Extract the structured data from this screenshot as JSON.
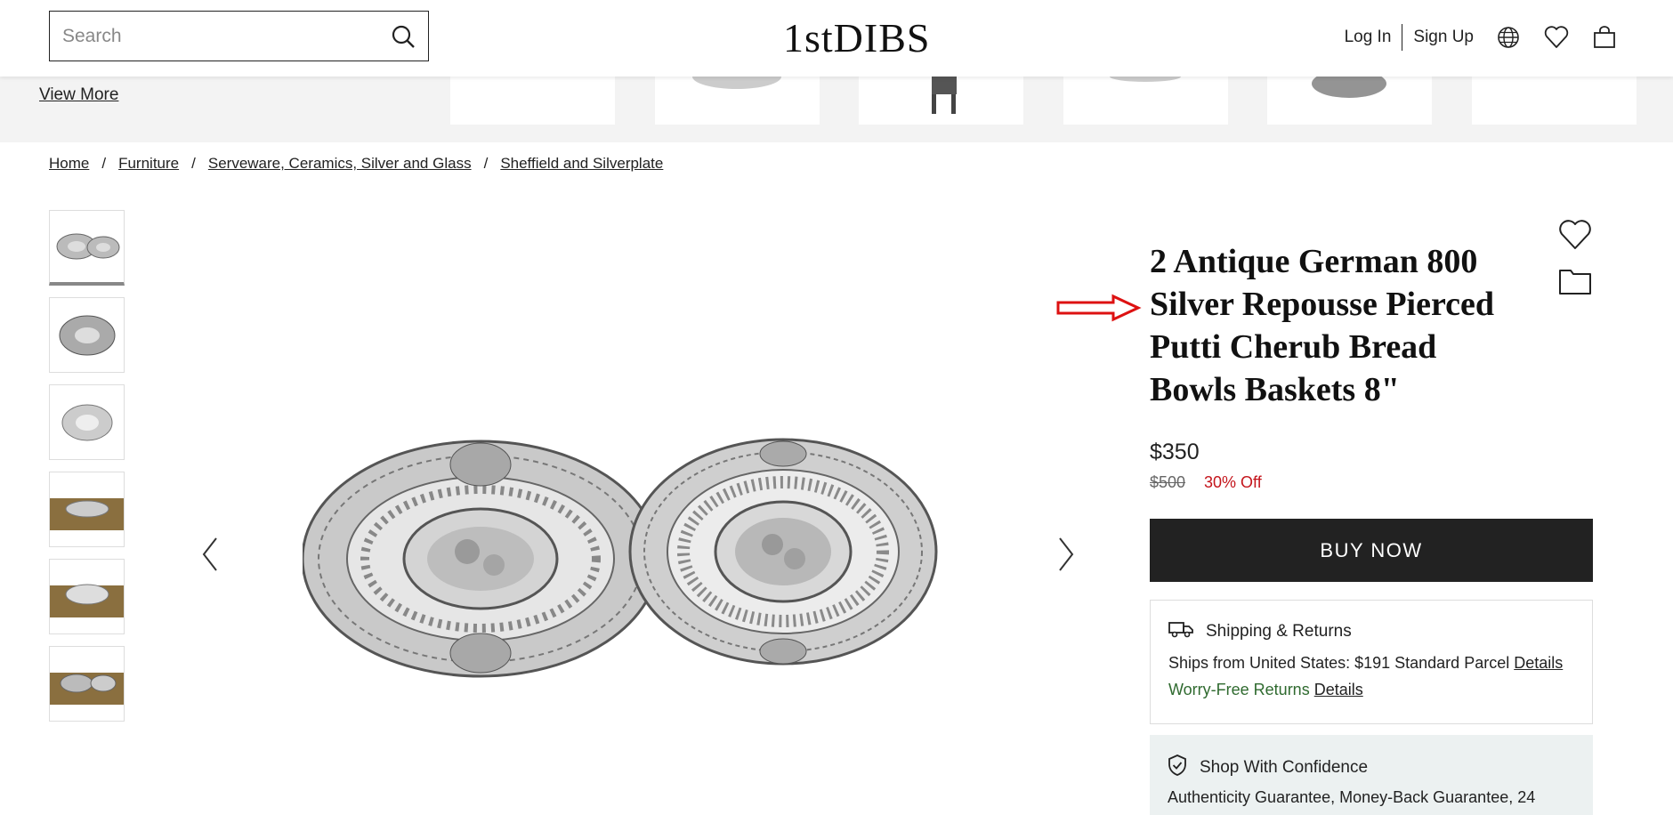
{
  "header": {
    "search_placeholder": "Search",
    "logo": "1stDIBS",
    "login_label": "Log In",
    "signup_label": "Sign Up"
  },
  "strip": {
    "view_more_label": "View More"
  },
  "breadcrumb": {
    "items": [
      "Home",
      "Furniture",
      "Serveware, Ceramics, Silver and Glass",
      "Sheffield and Silverplate"
    ],
    "separator": "/"
  },
  "product": {
    "title": "2 Antique German 800 Silver Repousse Pierced Putti Cherub Bread Bowls Baskets 8\"",
    "price": "$350",
    "original_price": "$500",
    "discount": "30% Off",
    "buy_label": "BUY NOW"
  },
  "shipping": {
    "heading": "Shipping & Returns",
    "ships_from": "Ships from United States: $191 Standard Parcel",
    "details_label": "Details",
    "returns_label": "Worry-Free Returns",
    "returns_details_label": "Details"
  },
  "confidence": {
    "heading": "Shop With Confidence",
    "text": "Authenticity Guarantee, Money-Back Guarantee, 24"
  },
  "colors": {
    "accent_red": "#c4151c",
    "returns_green": "#2f6a2f",
    "buy_button": "#222222"
  }
}
